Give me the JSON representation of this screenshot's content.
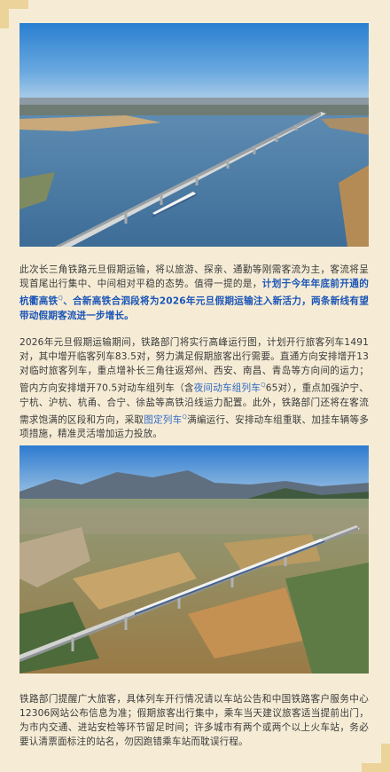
{
  "para1": {
    "lead": "此次长三角铁路元旦假期运输，将以旅游、探亲、通勤等刚需客流为主，客流将呈现首尾出行集中、中间相对平稳的态势。值得一提的是，",
    "hl1": "计划于今年年底前开通的杭衢高铁",
    "hl1_mark": "Q",
    "hl2": "、合新高铁合泗段将为2026年元旦假期运输注入新活力，两条新线有望带动假期客流进一步增长。"
  },
  "para2": {
    "text_a": "2026年元旦假期运输期间，铁路部门将实行高峰运行图，计划开行旅客列车1491对，其中增开临客列车83.5对，努力满足假期旅客出行需要。直通方向安排增开13对临时旅客列车，重点增补长三角往返郑州、西安、南昌、青岛等方向间的运力；管内方向安排增开70.5对动车组列车（含",
    "link1": "夜间动车组列车",
    "link1_mark": "Q",
    "text_b": "65对），重点加强沪宁、宁杭、沪杭、杭甬、合宁、徐盐等高铁沿线运力配置。此外，铁路部门还将在客流需求饱满的区段和方向，采取",
    "link2": "图定列车",
    "link2_mark": "Q",
    "text_c": "满编运行、安排动车组重联、加挂车辆等多项措施，精准灵活增加运力投放。"
  },
  "para3": {
    "text": "铁路部门提醒广大旅客，具体列车开行情况请以车站公告和中国铁路客户服务中心12306网站公布信息为准；假期旅客出行集中，乘车当天建议旅客适当提前出门，为市内交通、进站安检等环节留足时间；许多城市有两个或两个以上火车站，务必要认清票面标注的站名，勿因跑错乘车站而耽误行程。"
  },
  "colors": {
    "background": "#f6ecd6",
    "highlight": "#1a55b8",
    "link": "#2f68c4"
  }
}
